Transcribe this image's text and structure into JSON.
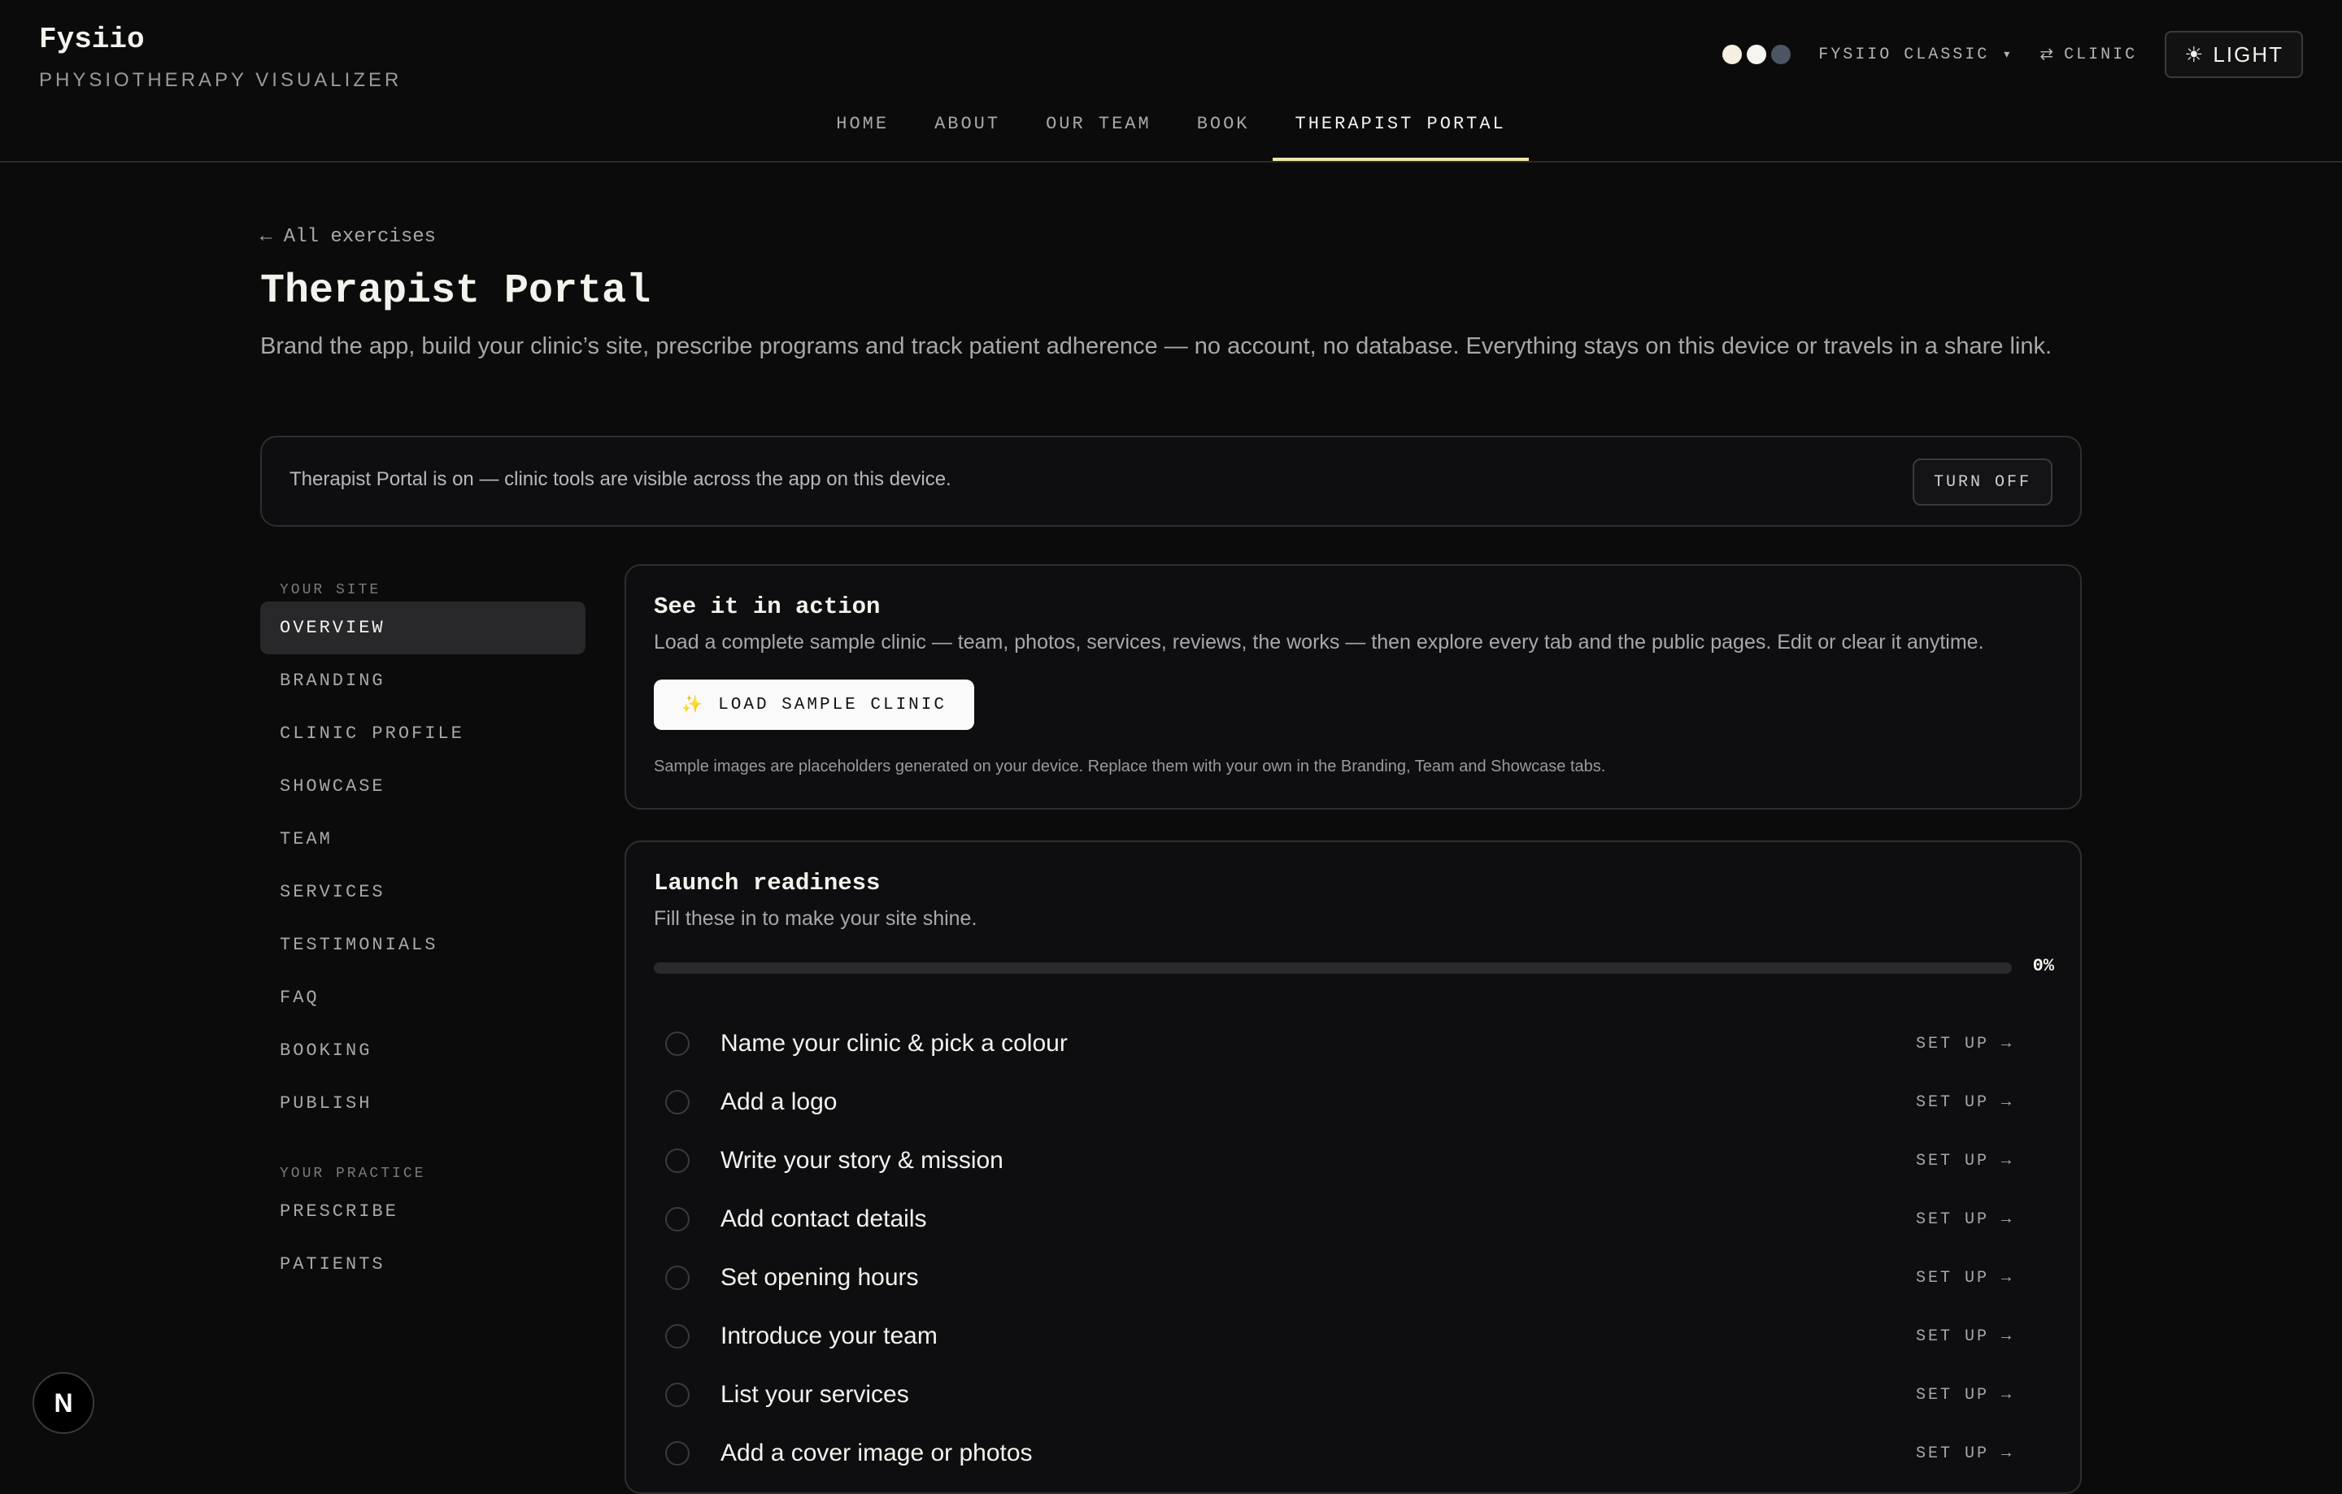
{
  "brand": {
    "name": "Fysiio",
    "tagline": "PHYSIOTHERAPY VISUALIZER"
  },
  "header": {
    "swatch_colors": [
      "#f4efe0",
      "#f7f5ef",
      "#4b5563"
    ],
    "theme_label": "FYSIIO CLASSIC",
    "theme_caret": "▾",
    "mode_switch_icon": "⇄",
    "mode_switch_label": "CLINIC",
    "light_icon": "☀",
    "light_label": "LIGHT"
  },
  "nav": {
    "items": [
      {
        "label": "HOME"
      },
      {
        "label": "ABOUT"
      },
      {
        "label": "OUR TEAM"
      },
      {
        "label": "BOOK"
      },
      {
        "label": "THERAPIST PORTAL",
        "active": true
      }
    ]
  },
  "page": {
    "back_link": "← All exercises",
    "title": "Therapist Portal",
    "subtitle": "Brand the app, build your clinic’s site, prescribe programs and track patient adherence — no account, no database. Everything stays on this device or travels in a share link."
  },
  "notice": {
    "text": "Therapist Portal is on — clinic tools are visible across the app on this device.",
    "button": "TURN OFF"
  },
  "sidebar": {
    "site_heading": "YOUR SITE",
    "site_items": [
      {
        "label": "OVERVIEW",
        "active": true
      },
      {
        "label": "BRANDING"
      },
      {
        "label": "CLINIC PROFILE"
      },
      {
        "label": "SHOWCASE"
      },
      {
        "label": "TEAM"
      },
      {
        "label": "SERVICES"
      },
      {
        "label": "TESTIMONIALS"
      },
      {
        "label": "FAQ"
      },
      {
        "label": "BOOKING"
      },
      {
        "label": "PUBLISH"
      }
    ],
    "practice_heading": "YOUR PRACTICE",
    "practice_items": [
      {
        "label": "PRESCRIBE"
      },
      {
        "label": "PATIENTS"
      }
    ]
  },
  "demo_card": {
    "title": "See it in action",
    "text": "Load a complete sample clinic — team, photos, services, reviews, the works — then explore every tab and the public pages. Edit or clear it anytime.",
    "button_icon": "✨",
    "button_label": "LOAD SAMPLE CLINIC",
    "note": "Sample images are placeholders generated on your device. Replace them with your own in the Branding, Team and Showcase tabs."
  },
  "readiness": {
    "title": "Launch readiness",
    "subtitle": "Fill these in to make your site shine.",
    "progress_percent": 0,
    "progress_label": "0%",
    "accent": "#f0e7a8",
    "items": [
      {
        "label": "Name your clinic & pick a colour",
        "action": "SET UP →"
      },
      {
        "label": "Add a logo",
        "action": "SET UP →"
      },
      {
        "label": "Write your story & mission",
        "action": "SET UP →"
      },
      {
        "label": "Add contact details",
        "action": "SET UP →"
      },
      {
        "label": "Set opening hours",
        "action": "SET UP →"
      },
      {
        "label": "Introduce your team",
        "action": "SET UP →"
      },
      {
        "label": "List your services",
        "action": "SET UP →"
      },
      {
        "label": "Add a cover image or photos",
        "action": "SET UP →"
      }
    ]
  },
  "dev_badge": {
    "label": "N"
  }
}
